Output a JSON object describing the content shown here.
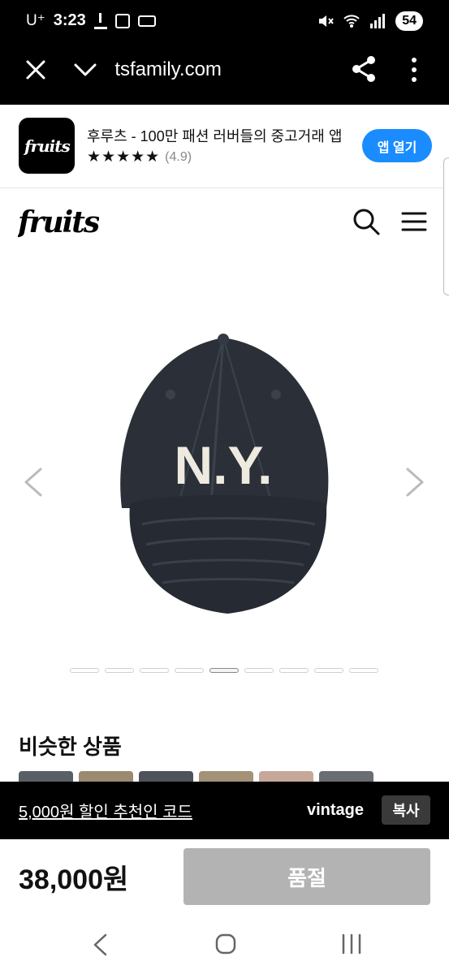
{
  "status_bar": {
    "carrier": "U⁺",
    "time": "3:23",
    "battery": "54"
  },
  "browser": {
    "url": "fruitsfamily.com"
  },
  "app_banner": {
    "title": "후루츠 - 100만 패션 러버들의 중고거래 앱",
    "stars": "★★★★★",
    "rating": "(4.9)",
    "open_button": "앱 열기",
    "logo_text": "fruits"
  },
  "site": {
    "logo_text": "fruits"
  },
  "product": {
    "cap_text": "N.Y.",
    "gallery_total": 9,
    "gallery_active_index": 4
  },
  "similar": {
    "title": "비슷한 상품"
  },
  "referral": {
    "link_text": "5,000원 할인 추천인 코드",
    "code": "vintage",
    "copy_button": "복사"
  },
  "purchase": {
    "price": "38,000원",
    "status_button": "품절"
  },
  "colors": {
    "accent_blue": "#1a8cff",
    "soldout_gray": "#b3b3b3",
    "cap_navy": "#2b3038"
  }
}
